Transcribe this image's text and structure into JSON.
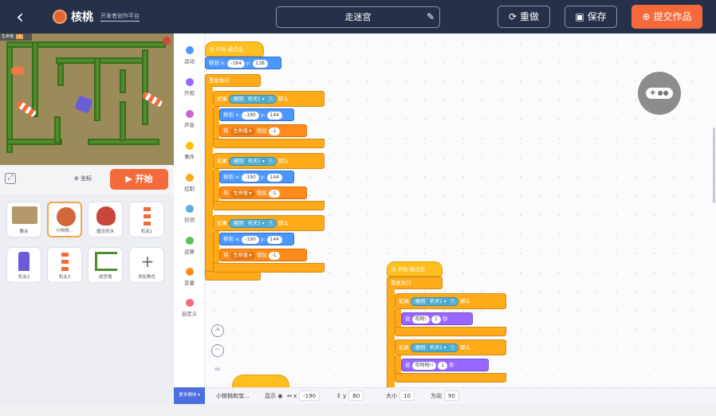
{
  "header": {
    "back_icon": "chevron-left-icon",
    "brand_name": "核桃",
    "brand_sub": "开发者创作平台",
    "project_title": "走迷宫",
    "reset_label": "重做",
    "save_label": "保存",
    "submit_label": "提交作品"
  },
  "stage": {
    "hud_label": "生命值",
    "hud_value": "3"
  },
  "controls": {
    "coord_label": "坐标",
    "start_label": "开始"
  },
  "sprites": [
    {
      "label": "舞台"
    },
    {
      "label": "小核桃..."
    },
    {
      "label": "魔法药水"
    },
    {
      "label": "机关1"
    },
    {
      "label": "机关2"
    },
    {
      "label": "机关3"
    },
    {
      "label": "迷宫墙"
    },
    {
      "label": "添加角色"
    }
  ],
  "categories": [
    {
      "label": "运动",
      "color": "#4c97ff"
    },
    {
      "label": "外观",
      "color": "#9966ff"
    },
    {
      "label": "声音",
      "color": "#cf63cf"
    },
    {
      "label": "事件",
      "color": "#ffbf00"
    },
    {
      "label": "控制",
      "color": "#ffab19"
    },
    {
      "label": "侦测",
      "color": "#5cb1d6"
    },
    {
      "label": "运算",
      "color": "#59c059"
    },
    {
      "label": "变量",
      "color": "#ff8c1a"
    },
    {
      "label": "自定义",
      "color": "#ff6680"
    }
  ],
  "more_blocks_label": "更多模块",
  "script1": {
    "hat": "当 开始 被点击",
    "goto_prefix": "移到 x:",
    "goto_y": "y:",
    "goto_x_val": "-184",
    "goto_y_val": "138",
    "forever": "重复执行",
    "if_word": "如果",
    "then_word": "那么",
    "touch_word": "碰到",
    "trap1": "机关1 ▾",
    "trap2": "机关2 ▾",
    "trap3": "机关3 ▾",
    "q": "?",
    "move_x": "-190",
    "move_y": "144",
    "set_word": "将",
    "var_name": "生命值 ▾",
    "inc_word": "增加",
    "inc_val": "-1"
  },
  "script2": {
    "hat": "当 开始 被点击",
    "forever": "重复执行",
    "say_word": "说",
    "say1": "哎呀!",
    "say2": "哎呀呀!!",
    "say_secs": "1",
    "secs_word": "秒"
  },
  "infobar": {
    "sprite_name": "小核桃和宝...",
    "show_label": "显示",
    "x_label": "x",
    "x_val": "-190",
    "y_label": "y",
    "y_val": "80",
    "size_label": "大小",
    "size_val": "10",
    "dir_label": "方向",
    "dir_val": "90"
  }
}
